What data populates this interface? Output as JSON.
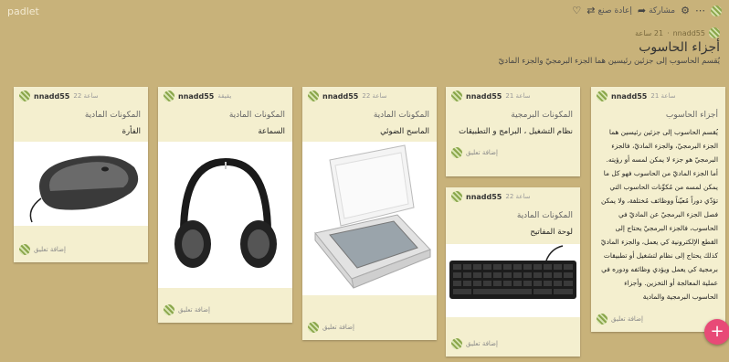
{
  "app": {
    "brand": "padlet"
  },
  "toolbar": {
    "share_label": "مشاركة",
    "remake_label": "إعادة صنع",
    "settings_icon": "gear-icon",
    "more_icon": "ellipsis-icon",
    "like_icon": "heart-icon",
    "remake_icon": "remake-icon",
    "share_icon": "share-arrow-icon"
  },
  "board": {
    "author": "nnadd55",
    "time": "21 ساعة",
    "title": "أجزاء الحاسوب",
    "description": "يُقسم الحاسوب إلى جزئين رئيسين هما الجزء البرمجيّ والجزء الماديّ"
  },
  "cards": [
    {
      "author": "nnadd55",
      "time": "21 ساعة",
      "title": "أجزاء الحاسوب",
      "body": "يُقسم الحاسوب إلى جزئين رئيسين هما الجزء البرمجيّ، والجزء الماديّ، فالجزء البرمجيّ هو جزء لا يمكن لمسه أو رؤيته. أما الجزء الماديّ من الحاسوب فهو كل ما يمكن لمسه من مُكوِّنات الحاسوب التي تؤدّي دوراً مُعيّناً ووظائف مُختلفة، ولا يمكن فصل الجزء البرمجيّ عن الماديّ في الحاسوب، فالجزء البرمجيّ يحتاج إلى القطع الإلكترونية كي يعمل، والجزء الماديّ كذلك يحتاج إلى نظام لتشغيل أو تطبيقات برمجية كي يعمل ويؤدي وظائفه ودوره في عملية المعالجة أو التخزين. وأجزاء الحاسوب البرمجية والمادية",
      "comment": "إضافة تعليق"
    },
    {
      "author": "nnadd55",
      "time": "21 ساعة",
      "title": "المكونات البرمجية",
      "subtitle": "نظام التشغيل ، البرامج و التطبيقات",
      "comment": "إضافة تعليق"
    },
    {
      "author": "nnadd55",
      "time": "22 ساعة",
      "title": "المكونات المادية",
      "subtitle": "لوحة المفاتيح",
      "comment": "إضافة تعليق"
    },
    {
      "author": "nnadd55",
      "time": "22 ساعة",
      "title": "المكونات المادية",
      "subtitle": "الماسح الضوئي",
      "comment": "إضافة تعليق"
    },
    {
      "author": "nnadd55",
      "time": "يقيقة",
      "title": "المكونات المادية",
      "subtitle": "السماعة",
      "comment": "إضافة تعليق"
    },
    {
      "author": "nnadd55",
      "time": "22 ساعة",
      "title": "المكونات المادية",
      "subtitle": "الفأرة",
      "comment": "إضافة تعليق"
    }
  ],
  "fab": {
    "label": "+"
  }
}
